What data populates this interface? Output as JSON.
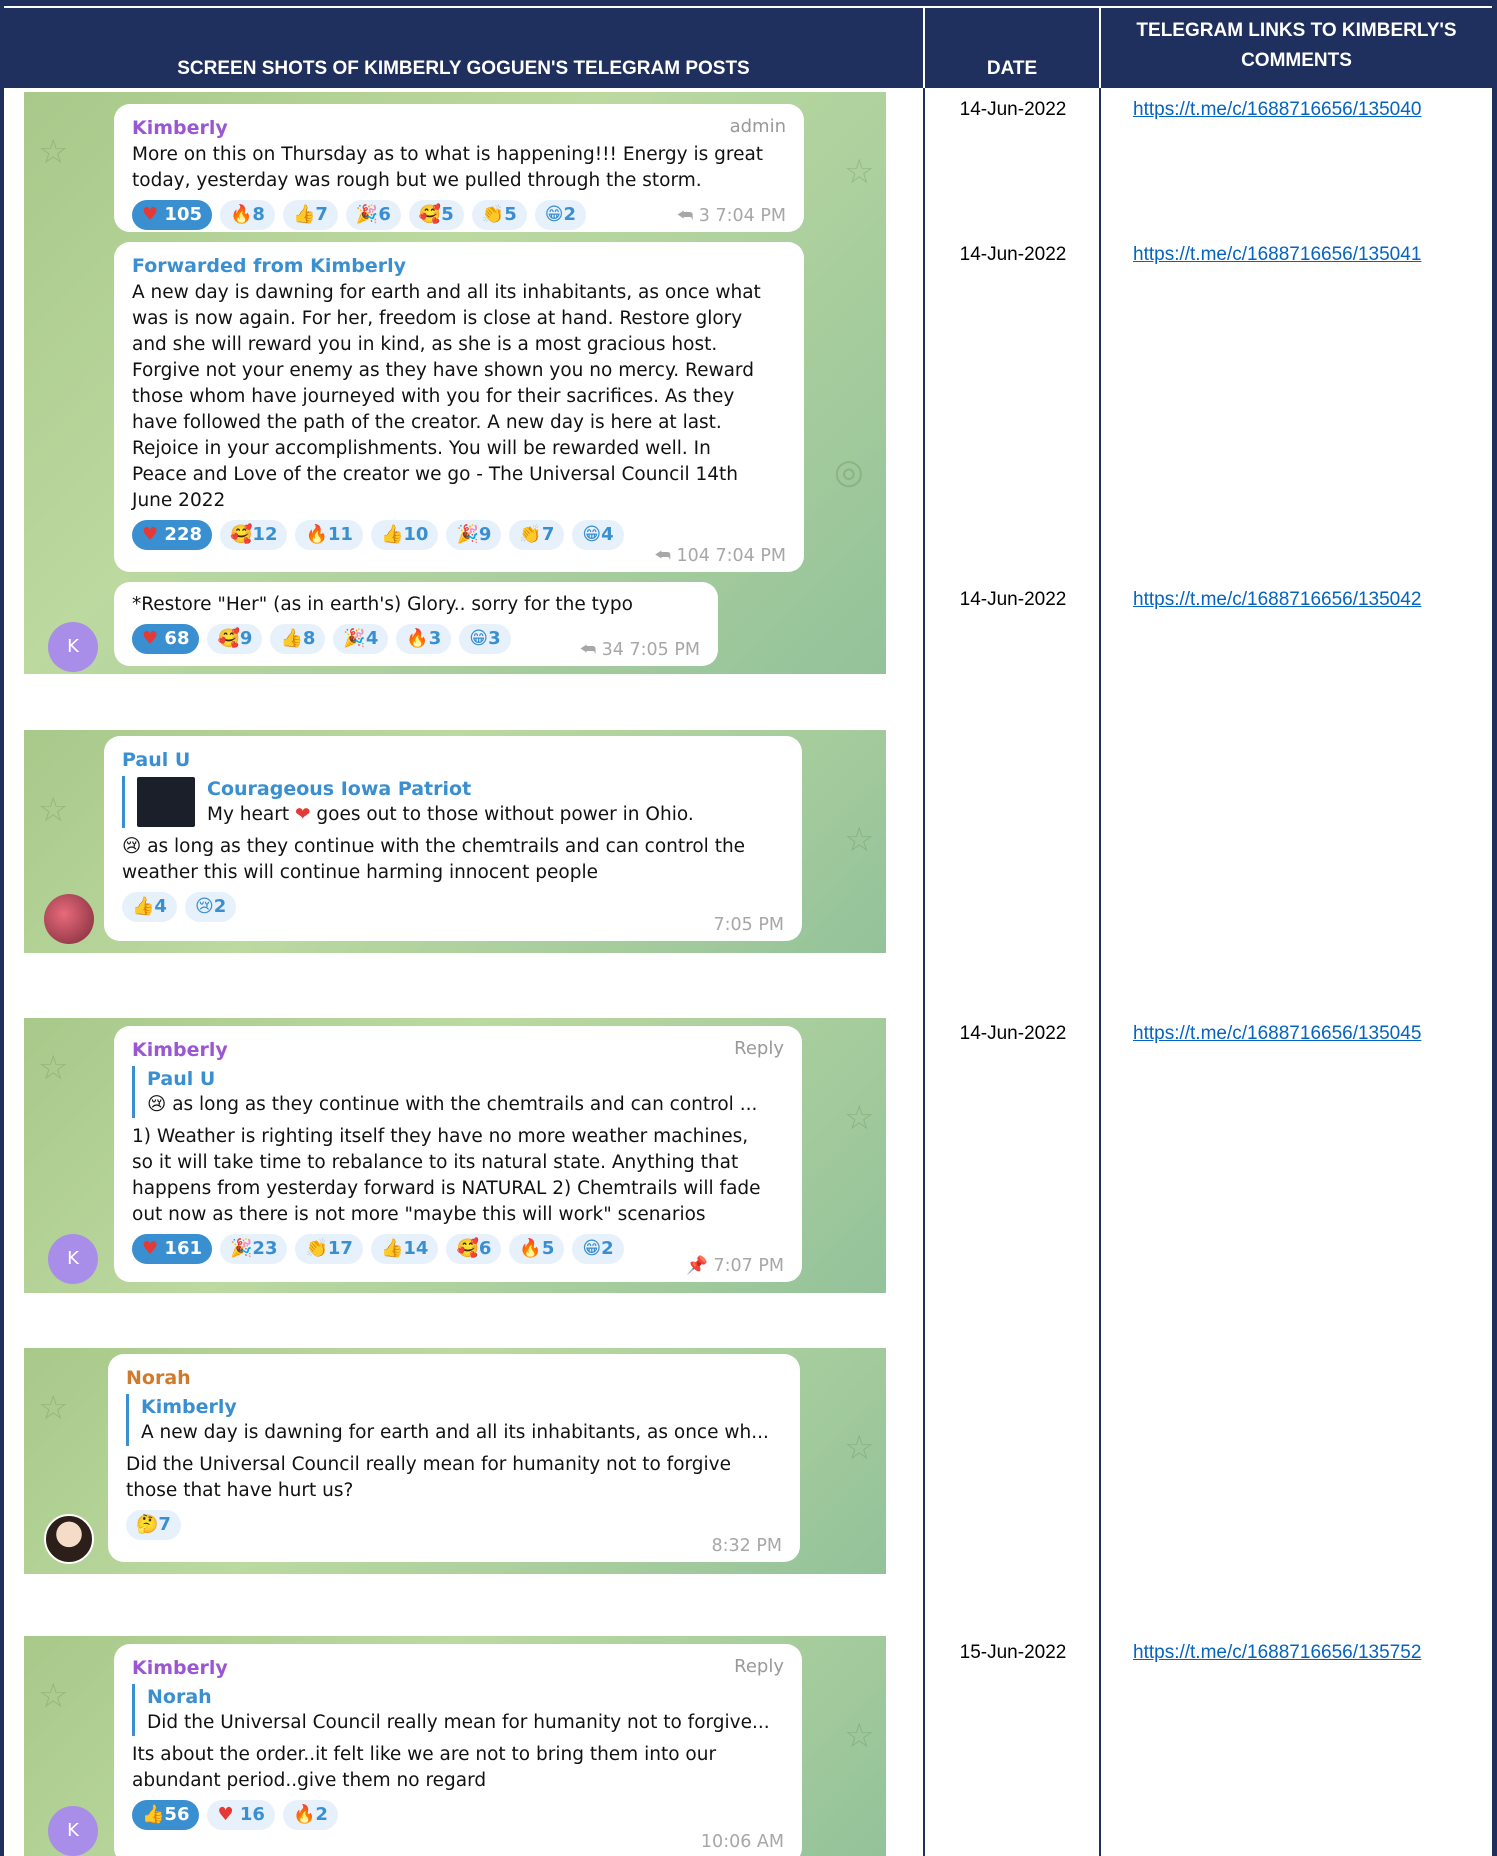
{
  "table": {
    "headers": {
      "screenshots": "SCREEN SHOTS OF KIMBERLY GOGUEN'S TELEGRAM POSTS",
      "date": "DATE",
      "links_line1": "TELEGRAM LINKS TO KIMBERLY'S",
      "links_line2": "COMMENTS"
    },
    "rows": [
      {
        "date": "14-Jun-2022",
        "link": "https://t.me/c/1688716656/135040"
      },
      {
        "date": "14-Jun-2022",
        "link": "https://t.me/c/1688716656/135041"
      },
      {
        "date": "14-Jun-2022",
        "link": "https://t.me/c/1688716656/135042"
      },
      {
        "date": "14-Jun-2022",
        "link": "https://t.me/c/1688716656/135045"
      },
      {
        "date": "15-Jun-2022",
        "link": "https://t.me/c/1688716656/135752"
      }
    ]
  },
  "shot1": {
    "m1": {
      "sender": "Kimberly",
      "role": "admin",
      "l1": "More on this on Thursday as to what is happening!!! Energy is great",
      "l2": "today, yesterday was rough but we pulled through the storm.",
      "reactions": [
        "105",
        "8",
        "7",
        "6",
        "5",
        "5",
        "2"
      ],
      "meta": "⮪ 3  7:04 PM"
    },
    "m2": {
      "sender": "Forwarded from Kimberly",
      "lines": [
        "A new day is dawning for earth and all its inhabitants, as once what",
        "was is now again. For her, freedom is close at hand. Restore glory",
        "and she will reward you in kind, as she is a most gracious host.",
        "Forgive not your enemy as they have shown you no mercy. Reward",
        "those whom have journeyed with you for their sacrifices. As they",
        "have followed the path of the creator. A new day is here at last.",
        "Rejoice in your accomplishments. You will be rewarded well. In",
        "Peace and Love of the creator we go - The Universal Council 14th",
        "June 2022"
      ],
      "reactions": [
        "228",
        "12",
        "11",
        "10",
        "9",
        "7",
        "4"
      ],
      "meta": "⮪ 104  7:04 PM"
    },
    "m3": {
      "text": "*Restore \"Her\" (as in earth's) Glory.. sorry for the typo",
      "reactions": [
        "68",
        "9",
        "8",
        "4",
        "3",
        "3"
      ],
      "meta": "⮪ 34  7:05 PM",
      "avatar": "K"
    }
  },
  "shot2": {
    "sender": "Paul U",
    "quote_name": "Courageous Iowa Patriot",
    "quote_text_a": "My heart",
    "quote_text_b": "goes out to those without power in Ohio.",
    "l1": "as long as they continue with the chemtrails and can control the",
    "l2": "weather this will continue harming innocent people",
    "reactions": [
      "4",
      "2"
    ],
    "meta": "7:05 PM"
  },
  "shot3": {
    "sender": "Kimberly",
    "role": "Reply",
    "quote_name": "Paul U",
    "quote_text": "as long as they continue with the chemtrails and can control ...",
    "lines": [
      "1) Weather is righting itself they have no more weather machines,",
      "so it will take time to rebalance to its natural state. Anything that",
      "happens from yesterday forward is NATURAL 2) Chemtrails will fade",
      "out now as there is not more \"maybe this will work\" scenarios"
    ],
    "reactions": [
      "161",
      "23",
      "17",
      "14",
      "6",
      "5",
      "2"
    ],
    "meta": "7:07 PM",
    "avatar": "K"
  },
  "shot4": {
    "sender": "Norah",
    "quote_name": "Kimberly",
    "quote_text": "A new day is dawning for earth and all its inhabitants, as once wh...",
    "l1": "Did the Universal Council really mean for humanity not to forgive",
    "l2": "those that have hurt us?",
    "reactions": [
      "7"
    ],
    "meta": "8:32 PM"
  },
  "shot5": {
    "sender": "Kimberly",
    "role": "Reply",
    "quote_name": "Norah",
    "quote_text": "Did the Universal Council really mean for humanity not to forgive...",
    "l1": "Its about the order..it felt like we are not to bring them into our",
    "l2": "abundant period..give them no regard",
    "reactions": [
      "56",
      "16",
      "2"
    ],
    "meta": "10:06 AM",
    "avatar": "K"
  },
  "colors": {
    "header_bg": "#1f305e",
    "link": "#0563c1",
    "accent": "#3a8fd1",
    "kimberly": "#9b57d3"
  },
  "icons": {
    "heart": "heart-icon",
    "fire": "fire-icon",
    "thumbs": "thumbs-up-icon",
    "party": "party-icon",
    "hearts_face": "love-face-icon",
    "clap": "clap-icon",
    "grin": "grin-icon",
    "cry": "cry-icon",
    "think": "thinking-icon",
    "reply": "reply-arrow-icon",
    "pin": "pin-icon"
  }
}
